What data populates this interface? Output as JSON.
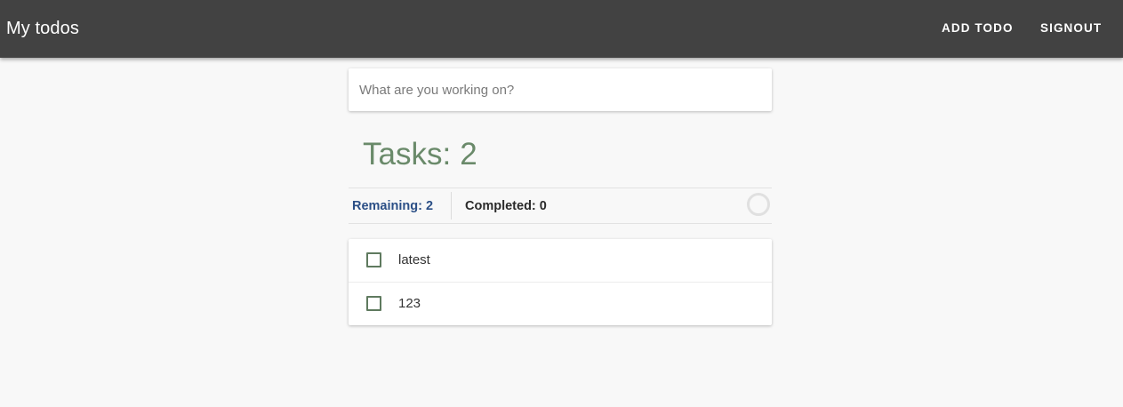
{
  "appbar": {
    "title": "My todos",
    "add_todo_label": "ADD TODO",
    "signout_label": "SIGNOUT",
    "background": "#424242"
  },
  "new_todo": {
    "placeholder": "What are you working on?",
    "value": ""
  },
  "tasks": {
    "label": "Tasks:",
    "count": "2",
    "color": "#6a8a6a"
  },
  "filters": {
    "remaining_label": "Remaining: 2",
    "completed_label": "Completed: 0",
    "active_color": "#2b4f86"
  },
  "todos": [
    {
      "text": "latest",
      "checked": false
    },
    {
      "text": "123",
      "checked": false
    }
  ]
}
